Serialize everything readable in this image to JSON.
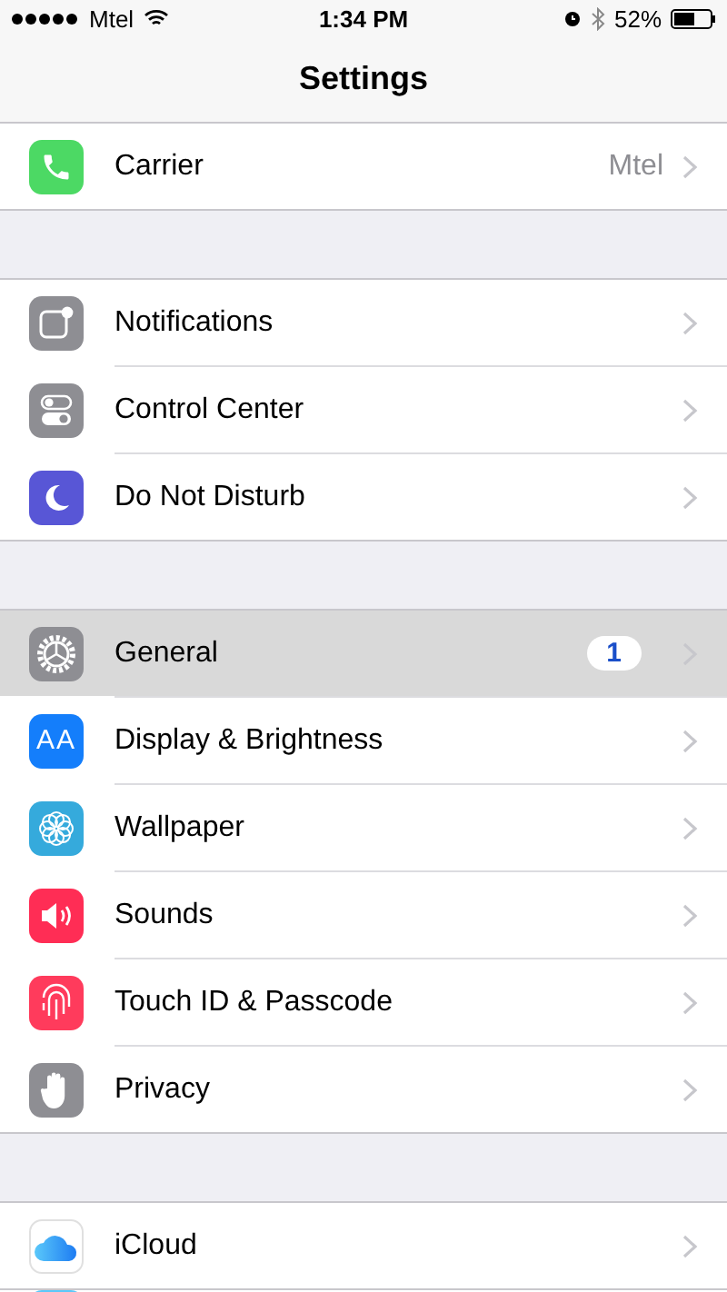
{
  "status_bar": {
    "carrier": "Mtel",
    "time": "1:34 PM",
    "battery": "52%"
  },
  "nav": {
    "title": "Settings"
  },
  "groups": [
    {
      "items": [
        {
          "kind": "phone",
          "color": "#4cd964",
          "label": "Carrier",
          "value": "Mtel",
          "selected": false
        }
      ]
    },
    {
      "items": [
        {
          "kind": "notifications",
          "color": "#8e8e93",
          "label": "Notifications",
          "selected": false
        },
        {
          "kind": "switches",
          "color": "#8e8e93",
          "label": "Control Center",
          "selected": false
        },
        {
          "kind": "moon",
          "color": "#5856d6",
          "label": "Do Not Disturb",
          "selected": false
        }
      ]
    },
    {
      "items": [
        {
          "kind": "gear",
          "color": "#8e8e93",
          "label": "General",
          "badge": "1",
          "selected": true
        },
        {
          "kind": "letters",
          "color": "#147efb",
          "icon_text": "AA",
          "label": "Display & Brightness",
          "selected": false
        },
        {
          "kind": "flower",
          "color": "#35aadc",
          "label": "Wallpaper",
          "selected": false
        },
        {
          "kind": "speaker",
          "color": "#ff2d55",
          "label": "Sounds",
          "selected": false
        },
        {
          "kind": "fingerprint",
          "color": "#ff3b5c",
          "label": "Touch ID & Passcode",
          "selected": false
        },
        {
          "kind": "hand",
          "color": "#8e8e93",
          "label": "Privacy",
          "selected": false
        }
      ]
    },
    {
      "items": [
        {
          "kind": "cloud",
          "color": "#ffffff",
          "label": "iCloud",
          "selected": false
        }
      ]
    }
  ]
}
